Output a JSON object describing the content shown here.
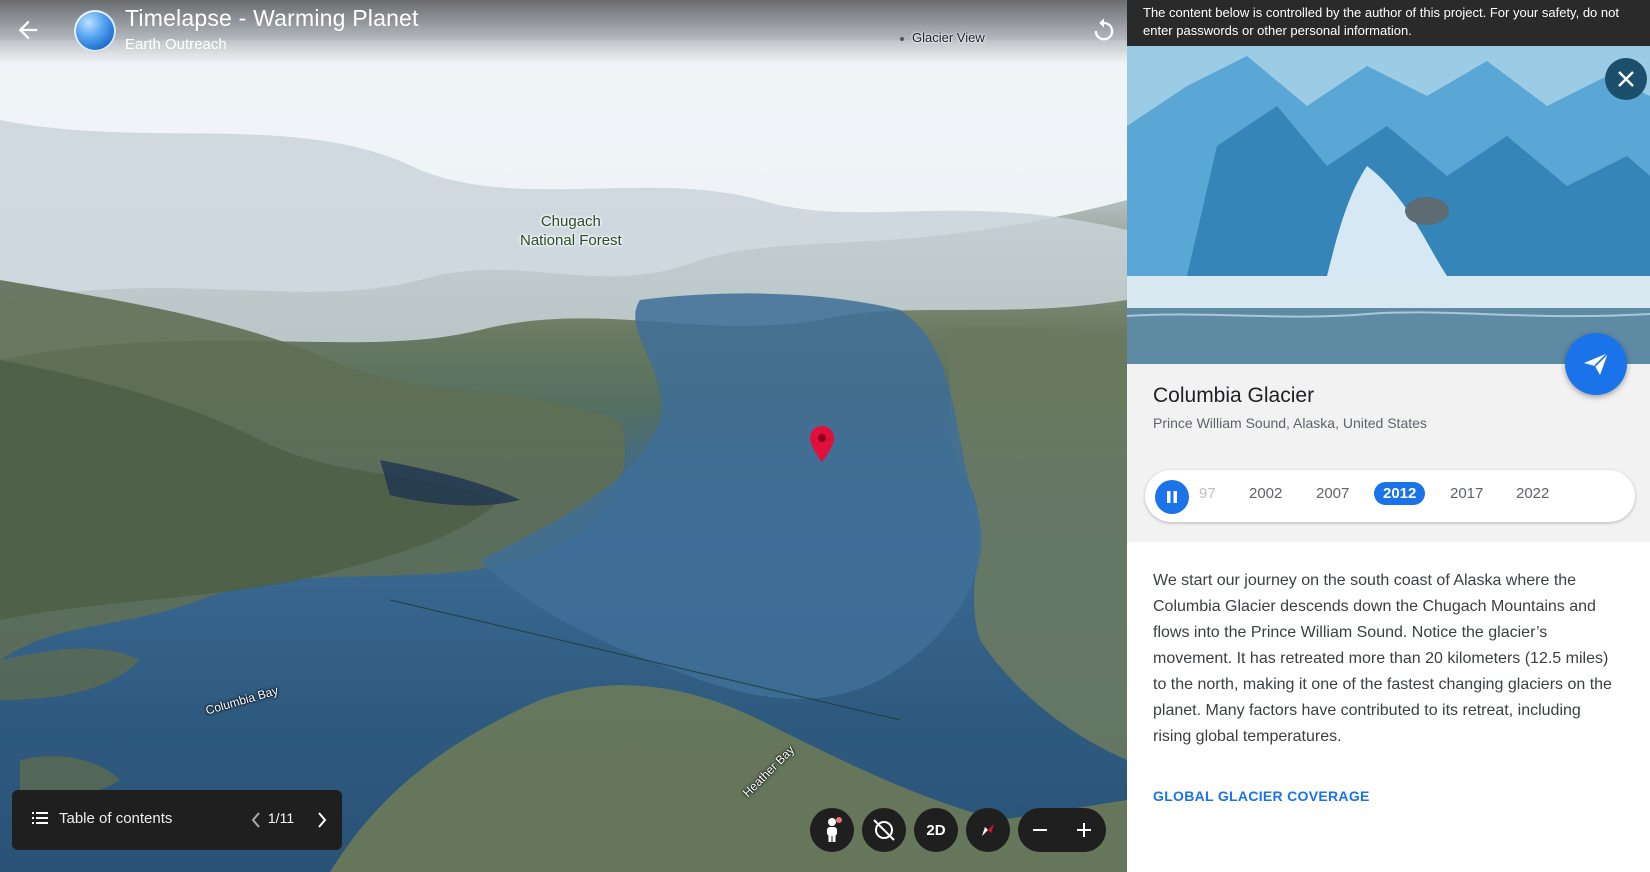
{
  "header": {
    "title": "Timelapse - Warming Planet",
    "author": "Earth Outreach"
  },
  "map": {
    "labels": {
      "forest_line1": "Chugach",
      "forest_line2": "National Forest",
      "glacier_view": "Glacier View",
      "columbia_bay": "Columbia Bay",
      "heather_bay": "Heather Bay"
    },
    "toc": {
      "label": "Table of contents",
      "page": "1/11"
    },
    "controls": {
      "view_mode": "2D"
    }
  },
  "panel": {
    "safety_notice": "The content below is controlled by the author of this project. For your safety, do not enter passwords or other personal information.",
    "place_title": "Columbia Glacier",
    "place_subtitle": "Prince William Sound, Alaska, United States",
    "years": [
      "97",
      "2002",
      "2007",
      "2012",
      "2017",
      "2022"
    ],
    "active_year": "2012",
    "description": "We start our journey on the south coast of Alaska where the Columbia Glacier descends down the Chugach Mountains and flows into the Prince William Sound. Notice the glacier’s movement. It has retreated more than 20 kilometers (12.5 miles) to the north, making it one of the fastest changing glaciers on the planet. Many factors have contributed to its retreat, including rising global temperatures.",
    "link_label": "GLOBAL GLACIER COVERAGE"
  },
  "colors": {
    "accent": "#1a73e8",
    "pin": "#e0103a",
    "close_bg": "#1b4f6b"
  }
}
